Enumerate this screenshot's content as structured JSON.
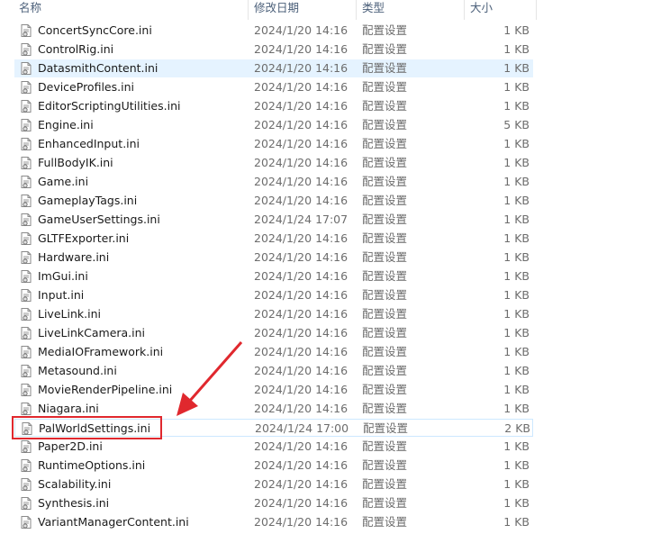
{
  "columns": {
    "name": "名称",
    "modified": "修改日期",
    "type": "类型",
    "size": "大小"
  },
  "files": [
    {
      "name": "ConcertSyncCore.ini",
      "modified": "2024/1/20 14:16",
      "type": "配置设置",
      "size": "1 KB"
    },
    {
      "name": "ControlRig.ini",
      "modified": "2024/1/20 14:16",
      "type": "配置设置",
      "size": "1 KB"
    },
    {
      "name": "DatasmithContent.ini",
      "modified": "2024/1/20 14:16",
      "type": "配置设置",
      "size": "1 KB"
    },
    {
      "name": "DeviceProfiles.ini",
      "modified": "2024/1/20 14:16",
      "type": "配置设置",
      "size": "1 KB"
    },
    {
      "name": "EditorScriptingUtilities.ini",
      "modified": "2024/1/20 14:16",
      "type": "配置设置",
      "size": "1 KB"
    },
    {
      "name": "Engine.ini",
      "modified": "2024/1/20 14:16",
      "type": "配置设置",
      "size": "5 KB"
    },
    {
      "name": "EnhancedInput.ini",
      "modified": "2024/1/20 14:16",
      "type": "配置设置",
      "size": "1 KB"
    },
    {
      "name": "FullBodyIK.ini",
      "modified": "2024/1/20 14:16",
      "type": "配置设置",
      "size": "1 KB"
    },
    {
      "name": "Game.ini",
      "modified": "2024/1/20 14:16",
      "type": "配置设置",
      "size": "1 KB"
    },
    {
      "name": "GameplayTags.ini",
      "modified": "2024/1/20 14:16",
      "type": "配置设置",
      "size": "1 KB"
    },
    {
      "name": "GameUserSettings.ini",
      "modified": "2024/1/24 17:07",
      "type": "配置设置",
      "size": "1 KB"
    },
    {
      "name": "GLTFExporter.ini",
      "modified": "2024/1/20 14:16",
      "type": "配置设置",
      "size": "1 KB"
    },
    {
      "name": "Hardware.ini",
      "modified": "2024/1/20 14:16",
      "type": "配置设置",
      "size": "1 KB"
    },
    {
      "name": "ImGui.ini",
      "modified": "2024/1/20 14:16",
      "type": "配置设置",
      "size": "1 KB"
    },
    {
      "name": "Input.ini",
      "modified": "2024/1/20 14:16",
      "type": "配置设置",
      "size": "1 KB"
    },
    {
      "name": "LiveLink.ini",
      "modified": "2024/1/20 14:16",
      "type": "配置设置",
      "size": "1 KB"
    },
    {
      "name": "LiveLinkCamera.ini",
      "modified": "2024/1/20 14:16",
      "type": "配置设置",
      "size": "1 KB"
    },
    {
      "name": "MediaIOFramework.ini",
      "modified": "2024/1/20 14:16",
      "type": "配置设置",
      "size": "1 KB"
    },
    {
      "name": "Metasound.ini",
      "modified": "2024/1/20 14:16",
      "type": "配置设置",
      "size": "1 KB"
    },
    {
      "name": "MovieRenderPipeline.ini",
      "modified": "2024/1/20 14:16",
      "type": "配置设置",
      "size": "1 KB"
    },
    {
      "name": "Niagara.ini",
      "modified": "2024/1/20 14:16",
      "type": "配置设置",
      "size": "1 KB"
    },
    {
      "name": "PalWorldSettings.ini",
      "modified": "2024/1/24 17:00",
      "type": "配置设置",
      "size": "2 KB"
    },
    {
      "name": "Paper2D.ini",
      "modified": "2024/1/20 14:16",
      "type": "配置设置",
      "size": "1 KB"
    },
    {
      "name": "RuntimeOptions.ini",
      "modified": "2024/1/20 14:16",
      "type": "配置设置",
      "size": "1 KB"
    },
    {
      "name": "Scalability.ini",
      "modified": "2024/1/20 14:16",
      "type": "配置设置",
      "size": "1 KB"
    },
    {
      "name": "Synthesis.ini",
      "modified": "2024/1/20 14:16",
      "type": "配置设置",
      "size": "1 KB"
    },
    {
      "name": "VariantManagerContent.ini",
      "modified": "2024/1/20 14:16",
      "type": "配置设置",
      "size": "1 KB"
    }
  ],
  "icon": "ini-config-file-icon",
  "hover_row": 2,
  "selected_row": 21,
  "colors": {
    "hover_bg": "#e5f3ff",
    "selected_border": "#cde8ff",
    "annotation_red": "#e0282e",
    "header_text": "#4c607a",
    "secondary_text": "#6d6d6d"
  }
}
